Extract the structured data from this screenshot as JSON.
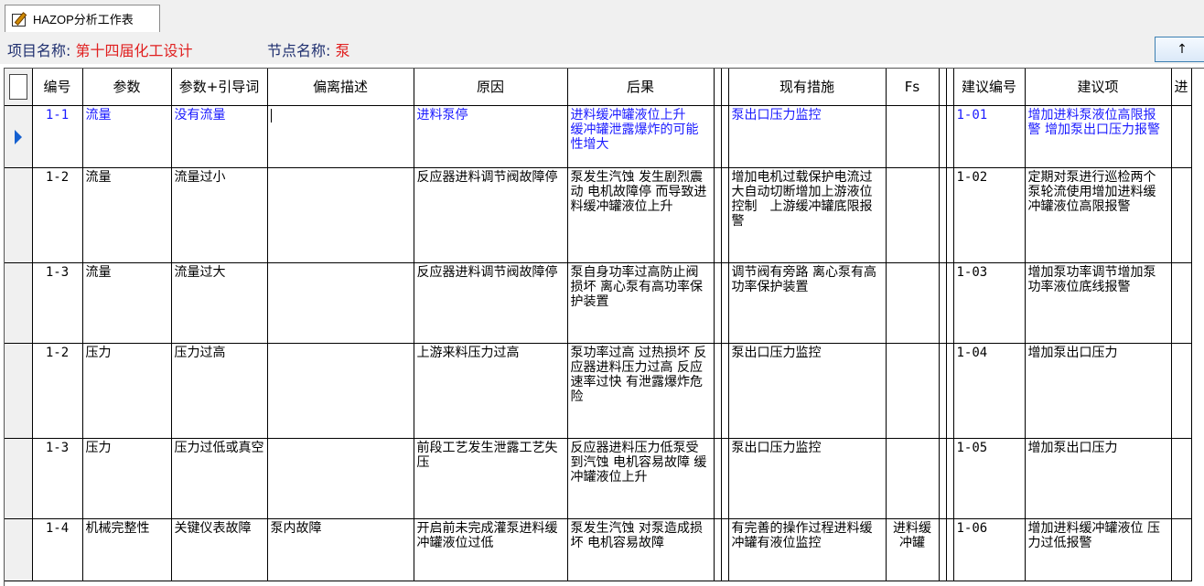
{
  "tab": {
    "label": "HAZOP分析工作表",
    "icon": "worksheet-edit-icon"
  },
  "header": {
    "project_key": "项目名称:",
    "project_value": "第十四届化工设计",
    "node_key": "节点名称:",
    "node_value": "泵",
    "up_button_label": "↑"
  },
  "colors": {
    "accent_red": "#e02020",
    "current_row_text": "#1a1aff",
    "pointer_blue": "#1560d0"
  },
  "columns": {
    "id": "编号",
    "param": "参数",
    "guide": "参数+引导词",
    "deviation": "偏离描述",
    "cause": "原因",
    "consequence": "后果",
    "measures": "现有措施",
    "fs": "Fs",
    "sugg_id": "建议编号",
    "sugg": "建议项",
    "extra": "进"
  },
  "rows": [
    {
      "id": "1-1",
      "param": "流量",
      "guide": "没有流量",
      "deviation": "",
      "cause": "进料泵停",
      "consequence": "进料缓冲罐液位上升　缓冲罐泄露爆炸的可能性增大",
      "measures": "泵出口压力监控",
      "fs": "",
      "sugg_id": "1-01",
      "sugg": "增加进料泵液位高限报警 增加泵出口压力报警"
    },
    {
      "id": "1-2",
      "param": "流量",
      "guide": "流量过小",
      "deviation": "",
      "cause": "反应器进料调节阀故障停",
      "consequence": "泵发生汽蚀 发生剧烈震动 电机故障停 而导致进料缓冲罐液位上升",
      "measures": "增加电机过载保护电流过大自动切断增加上游液位控制　上游缓冲罐底限报警",
      "fs": "",
      "sugg_id": "1-02",
      "sugg": "定期对泵进行巡检两个泵轮流使用增加进料缓冲罐液位高限报警"
    },
    {
      "id": "1-3",
      "param": "流量",
      "guide": "流量过大",
      "deviation": "",
      "cause": "反应器进料调节阀故障停",
      "consequence": "泵自身功率过高防止阀损坏 离心泵有高功率保护装置",
      "measures": "调节阀有旁路 离心泵有高功率保护装置",
      "fs": "",
      "sugg_id": "1-03",
      "sugg": "增加泵功率调节增加泵功率液位底线报警"
    },
    {
      "id": "1-2",
      "param": "压力",
      "guide": "压力过高",
      "deviation": "",
      "cause": "上游来料压力过高",
      "consequence": "泵功率过高 过热损坏 反应器进料压力过高 反应速率过快 有泄露爆炸危险",
      "measures": "泵出口压力监控",
      "fs": "",
      "sugg_id": "1-04",
      "sugg": "增加泵出口压力"
    },
    {
      "id": "1-3",
      "param": "压力",
      "guide": "压力过低或真空",
      "deviation": "",
      "cause": "前段工艺发生泄露工艺失压",
      "consequence": "反应器进料压力低泵受到汽蚀 电机容易故障 缓冲罐液位上升",
      "measures": "泵出口压力监控",
      "fs": "",
      "sugg_id": "1-05",
      "sugg": "增加泵出口压力"
    },
    {
      "id": "1-4",
      "param": "机械完整性",
      "guide": "关键仪表故障",
      "deviation": "泵内故障",
      "cause": "开启前未完成灌泵进料缓冲罐液位过低",
      "consequence": "泵发生汽蚀 对泵造成损坏 电机容易故障",
      "measures": "有完善的操作过程进料缓冲罐有液位监控",
      "fs": "进料缓冲罐",
      "sugg_id": "1-06",
      "sugg": "增加进料缓冲罐液位 压力过低报警"
    }
  ]
}
